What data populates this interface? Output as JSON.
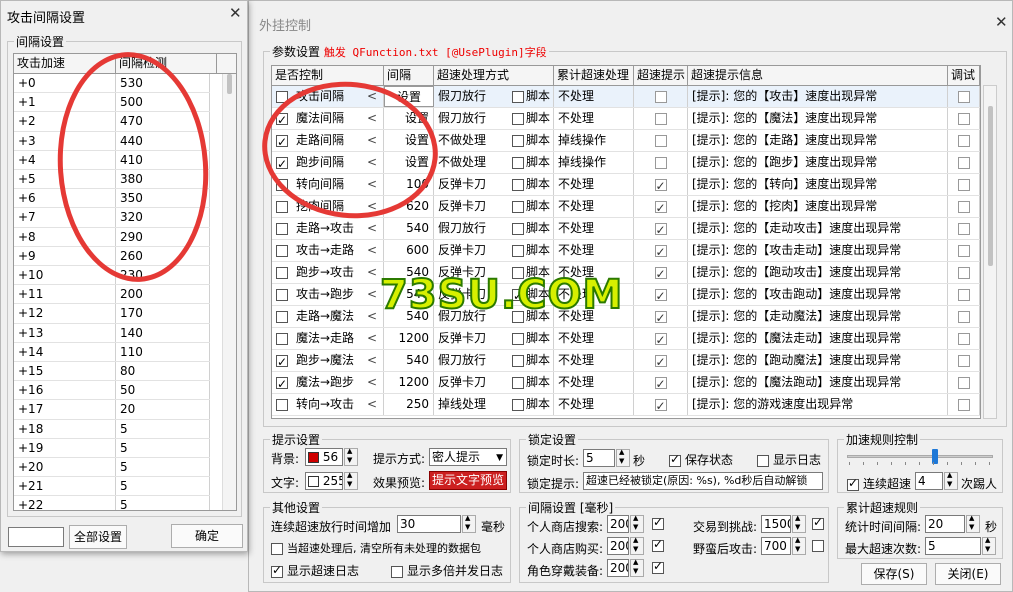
{
  "left_window": {
    "title": "攻击间隔设置",
    "group": "间隔设置",
    "headers": [
      "攻击加速",
      "间隔检测"
    ],
    "rows": [
      [
        "+0",
        "530"
      ],
      [
        "+1",
        "500"
      ],
      [
        "+2",
        "470"
      ],
      [
        "+3",
        "440"
      ],
      [
        "+4",
        "410"
      ],
      [
        "+5",
        "380"
      ],
      [
        "+6",
        "350"
      ],
      [
        "+7",
        "320"
      ],
      [
        "+8",
        "290"
      ],
      [
        "+9",
        "260"
      ],
      [
        "+10",
        "230"
      ],
      [
        "+11",
        "200"
      ],
      [
        "+12",
        "170"
      ],
      [
        "+13",
        "140"
      ],
      [
        "+14",
        "110"
      ],
      [
        "+15",
        "80"
      ],
      [
        "+16",
        "50"
      ],
      [
        "+17",
        "20"
      ],
      [
        "+18",
        "5"
      ],
      [
        "+19",
        "5"
      ],
      [
        "+20",
        "5"
      ],
      [
        "+21",
        "5"
      ],
      [
        "+22",
        "5"
      ]
    ],
    "all_set_label": "全部设置",
    "ok_label": "确定",
    "close": "✕"
  },
  "right_window": {
    "title": "外挂控制",
    "close": "✕",
    "params": {
      "legend": "参数设置",
      "legend_red": "触发 QFunction.txt [@UsePlugin]字段",
      "headers": [
        "是否控制",
        "间隔",
        "超速处理方式",
        "累计超速处理",
        "超速提示",
        "超速提示信息",
        "调试"
      ],
      "script_label": "脚本",
      "rows": [
        {
          "on": false,
          "name": "攻击间隔",
          "interval": "设置",
          "method": "假刀放行",
          "script": false,
          "accum": "不处理",
          "tip": false,
          "msg": "[提示]: 您的【攻击】速度出现异常",
          "debug": false
        },
        {
          "on": true,
          "name": "魔法间隔",
          "interval": "设置",
          "method": "假刀放行",
          "script": false,
          "accum": "不处理",
          "tip": false,
          "msg": "[提示]: 您的【魔法】速度出现异常",
          "debug": false
        },
        {
          "on": true,
          "name": "走路间隔",
          "interval": "设置",
          "method": "不做处理",
          "script": false,
          "accum": "掉线操作",
          "tip": false,
          "msg": "[提示]: 您的【走路】速度出现异常",
          "debug": false
        },
        {
          "on": true,
          "name": "跑步间隔",
          "interval": "设置",
          "method": "不做处理",
          "script": false,
          "accum": "掉线操作",
          "tip": false,
          "msg": "[提示]: 您的【跑步】速度出现异常",
          "debug": false
        },
        {
          "on": false,
          "name": "转向间隔",
          "interval": "100",
          "method": "反弹卡刀",
          "script": false,
          "accum": "不处理",
          "tip": true,
          "msg": "[提示]: 您的【转向】速度出现异常",
          "debug": false
        },
        {
          "on": false,
          "name": "挖肉间隔",
          "interval": "620",
          "method": "反弹卡刀",
          "script": false,
          "accum": "不处理",
          "tip": true,
          "msg": "[提示]: 您的【挖肉】速度出现异常",
          "debug": false
        },
        {
          "on": false,
          "name": "走路→攻击",
          "interval": "540",
          "method": "假刀放行",
          "script": false,
          "accum": "不处理",
          "tip": true,
          "msg": "[提示]: 您的【走动攻击】速度出现异常",
          "debug": false
        },
        {
          "on": false,
          "name": "攻击→走路",
          "interval": "600",
          "method": "反弹卡刀",
          "script": false,
          "accum": "不处理",
          "tip": true,
          "msg": "[提示]: 您的【攻击走动】速度出现异常",
          "debug": false
        },
        {
          "on": false,
          "name": "跑步→攻击",
          "interval": "540",
          "method": "反弹卡刀",
          "script": false,
          "accum": "不处理",
          "tip": true,
          "msg": "[提示]: 您的【跑动攻击】速度出现异常",
          "debug": false
        },
        {
          "on": false,
          "name": "攻击→跑步",
          "interval": "540",
          "method": "反弹卡刀",
          "script": true,
          "accum": "不处理",
          "tip": true,
          "msg": "[提示]: 您的【攻击跑动】速度出现异常",
          "debug": false
        },
        {
          "on": false,
          "name": "走路→魔法",
          "interval": "540",
          "method": "假刀放行",
          "script": false,
          "accum": "不处理",
          "tip": true,
          "msg": "[提示]: 您的【走动魔法】速度出现异常",
          "debug": false
        },
        {
          "on": false,
          "name": "魔法→走路",
          "interval": "1200",
          "method": "反弹卡刀",
          "script": false,
          "accum": "不处理",
          "tip": true,
          "msg": "[提示]: 您的【魔法走动】速度出现异常",
          "debug": false
        },
        {
          "on": true,
          "name": "跑步→魔法",
          "interval": "540",
          "method": "假刀放行",
          "script": false,
          "accum": "不处理",
          "tip": true,
          "msg": "[提示]: 您的【跑动魔法】速度出现异常",
          "debug": false
        },
        {
          "on": true,
          "name": "魔法→跑步",
          "interval": "1200",
          "method": "反弹卡刀",
          "script": false,
          "accum": "不处理",
          "tip": true,
          "msg": "[提示]: 您的【魔法跑动】速度出现异常",
          "debug": false
        },
        {
          "on": false,
          "name": "转向→攻击",
          "interval": "250",
          "method": "掉线处理",
          "script": false,
          "accum": "不处理",
          "tip": true,
          "msg": "[提示]: 您的游戏速度出现异常",
          "debug": false
        }
      ]
    },
    "tip_settings": {
      "legend": "提示设置",
      "bg_label": "背景:",
      "bg_value": "56",
      "text_label": "文字:",
      "text_value": "255",
      "mode_label": "提示方式:",
      "mode_value": "密人提示",
      "preview_label": "效果预览:",
      "preview_value": "提示文字预览"
    },
    "lock_settings": {
      "legend": "锁定设置",
      "duration_label": "锁定时长:",
      "duration_value": "5",
      "duration_unit": "秒",
      "save_state_label": "保存状态",
      "save_state": true,
      "show_log_label": "显示日志",
      "show_log": false,
      "tip_label": "锁定提示:",
      "tip_value": "超速已经被锁定(原因: %s), %d秒后自动解锁"
    },
    "accel_rule": {
      "legend": "加速规则控制",
      "continuous_label": "连续超速",
      "continuous": true,
      "count_value": "4",
      "count_unit": "次踢人"
    },
    "other_settings": {
      "legend": "其他设置",
      "inc_label": "连续超速放行时间增加",
      "inc_value": "30",
      "inc_unit": "毫秒",
      "clear_label": "当超速处理后, 清空所有未处理的数据包",
      "clear": false,
      "show_log_label": "显示超速日志",
      "show_log": true,
      "show_multi_label": "显示多倍并发日志",
      "show_multi": false
    },
    "interval_settings": {
      "legend": "间隔设置 [毫秒]",
      "shop_search_label": "个人商店搜索:",
      "shop_search_value": "200",
      "shop_search_on": true,
      "shop_buy_label": "个人商店购买:",
      "shop_buy_value": "200",
      "shop_buy_on": true,
      "equip_label": "角色穿戴装备:",
      "equip_value": "200",
      "equip_on": true,
      "trade_label": "交易到挑战:",
      "trade_value": "1500",
      "trade_on": true,
      "barb_label": "野蛮后攻击:",
      "barb_value": "700",
      "barb_on": false
    },
    "accum_rule": {
      "legend": "累计超速规则",
      "interval_label": "统计时间间隔:",
      "interval_value": "20",
      "interval_unit": "秒",
      "max_label": "最大超速次数:",
      "max_value": "5"
    },
    "save_label": "保存(S)",
    "close_label": "关闭(E)"
  },
  "watermark": "73SU.COM",
  "colors": {
    "annotation_red": "#e53935",
    "preview_red": "#cc2020",
    "bg_swatch": "#d00000"
  }
}
